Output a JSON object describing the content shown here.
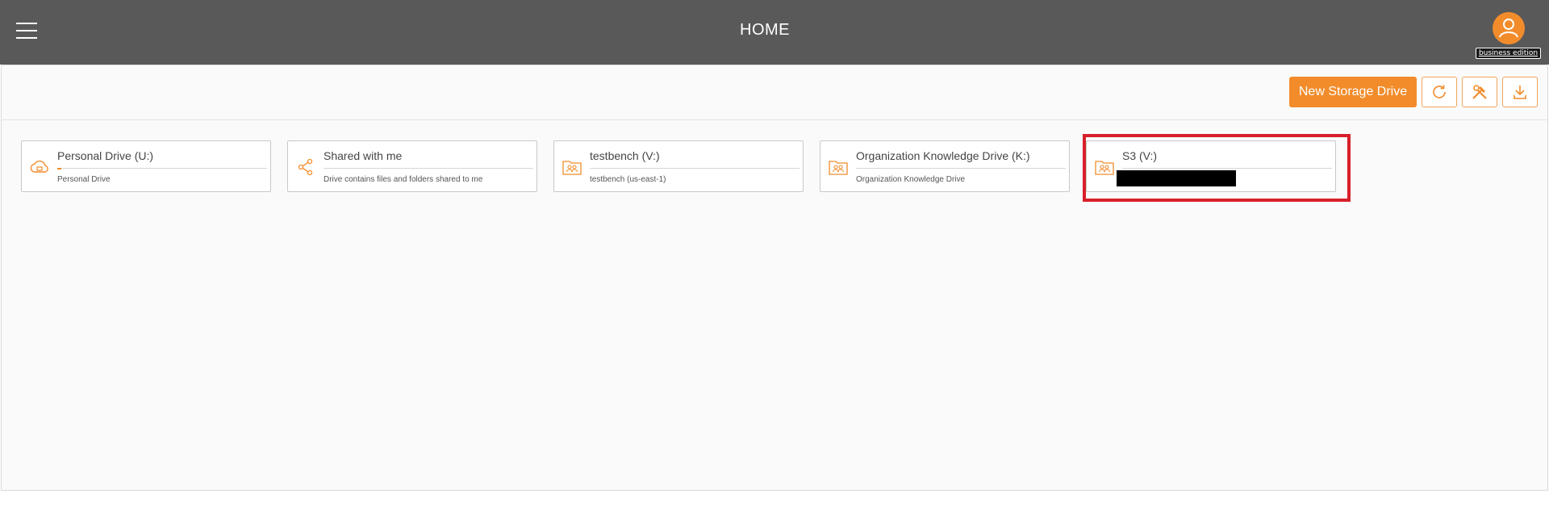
{
  "header": {
    "title": "HOME",
    "edition_badge": "business edition"
  },
  "toolbar": {
    "new_drive_label": "New Storage Drive",
    "refresh_icon": "refresh-icon",
    "tools_icon": "tools-icon",
    "download_icon": "download-icon"
  },
  "drives": [
    {
      "name": "Personal Drive (U:)",
      "description": "Personal Drive",
      "icon": "cloud-icon",
      "usage": 0.02
    },
    {
      "name": "Shared with me",
      "description": "Drive contains files and folders shared to me",
      "icon": "share-icon"
    },
    {
      "name": "testbench (V:)",
      "description": "testbench (us-east-1)",
      "icon": "group-folder-icon"
    },
    {
      "name": "Organization Knowledge Drive (K:)",
      "description": "Organization Knowledge Drive",
      "icon": "group-folder-icon"
    },
    {
      "name": "S3 (V:)",
      "description": "",
      "icon": "group-folder-icon",
      "highlighted": true
    }
  ],
  "colors": {
    "accent": "#f28c2b",
    "header_bg": "#595959",
    "highlight": "#d8202a"
  }
}
